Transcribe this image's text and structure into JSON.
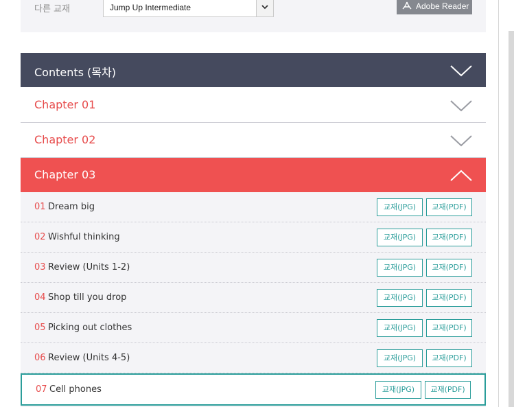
{
  "top": {
    "other_label": "다른 교재",
    "select_value": "Jump Up Intermediate",
    "adobe_label": "Adobe Reader"
  },
  "toc": {
    "title": "Contents (목차)"
  },
  "chapters": [
    {
      "label": "Chapter 01",
      "expanded": false
    },
    {
      "label": "Chapter 02",
      "expanded": false
    },
    {
      "label": "Chapter 03",
      "expanded": true
    }
  ],
  "units": [
    {
      "num": "01",
      "title": "Dream big",
      "jpg": "교재(JPG)",
      "pdf": "교재(PDF)"
    },
    {
      "num": "02",
      "title": "Wishful thinking",
      "jpg": "교재(JPG)",
      "pdf": "교재(PDF)"
    },
    {
      "num": "03",
      "title": "Review (Units 1-2)",
      "jpg": "교재(JPG)",
      "pdf": "교재(PDF)"
    },
    {
      "num": "04",
      "title": "Shop till you drop",
      "jpg": "교재(JPG)",
      "pdf": "교재(PDF)"
    },
    {
      "num": "05",
      "title": "Picking out clothes",
      "jpg": "교재(JPG)",
      "pdf": "교재(PDF)"
    },
    {
      "num": "06",
      "title": "Review (Units 4-5)",
      "jpg": "교재(JPG)",
      "pdf": "교재(PDF)"
    },
    {
      "num": "07",
      "title": "Cell phones",
      "jpg": "교재(JPG)",
      "pdf": "교재(PDF)"
    }
  ],
  "colors": {
    "header_bg": "#454a5e",
    "accent_red": "#ef5151",
    "teal": "#2a9d9a"
  }
}
